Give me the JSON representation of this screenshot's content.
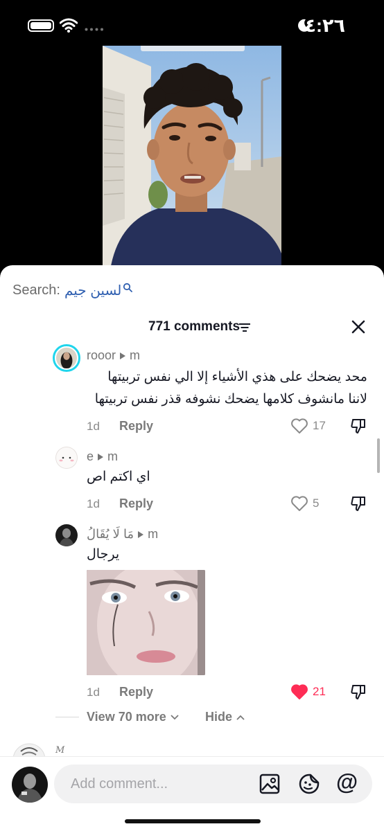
{
  "status_bar": {
    "time": "٤:٢٦"
  },
  "search": {
    "label": "Search:",
    "term": "لسين جيم"
  },
  "comments_header": {
    "count_label": "771 comments"
  },
  "replies": [
    {
      "username": "rooor",
      "to": "m",
      "text": "محد يضحك على هذي الأشياء إلا الي نفس تربيتها لاننا مانشوف كلامها يضحك نشوفه قذر نفس تربيتها",
      "date": "1d",
      "reply_label": "Reply",
      "likes": "17",
      "liked": false
    },
    {
      "username": "e",
      "to": "m",
      "text": "اي اكتم اص",
      "date": "1d",
      "reply_label": "Reply",
      "likes": "5",
      "liked": false
    },
    {
      "username": "مَا لَا يُقَالُ",
      "to": "m",
      "text": "يرجال",
      "date": "1d",
      "reply_label": "Reply",
      "likes": "21",
      "liked": true
    }
  ],
  "thread_controls": {
    "view_more_label": "View 70 more",
    "hide_label": "Hide"
  },
  "next_comment_peek": {
    "letter": "M"
  },
  "composer": {
    "placeholder": "Add comment...",
    "at_symbol": "@"
  },
  "icons": [
    "moon-icon",
    "wifi-icon",
    "battery-icon",
    "search-icon",
    "filter-icon",
    "close-icon",
    "heart-icon",
    "dislike-icon",
    "image-icon",
    "emoji-sticker-icon",
    "mention-icon",
    "chevron-down-icon",
    "chevron-up-icon"
  ],
  "colors": {
    "accent_like": "#fe2c55",
    "story_ring": "#20d5ec",
    "search_link": "#2f5fb0"
  }
}
